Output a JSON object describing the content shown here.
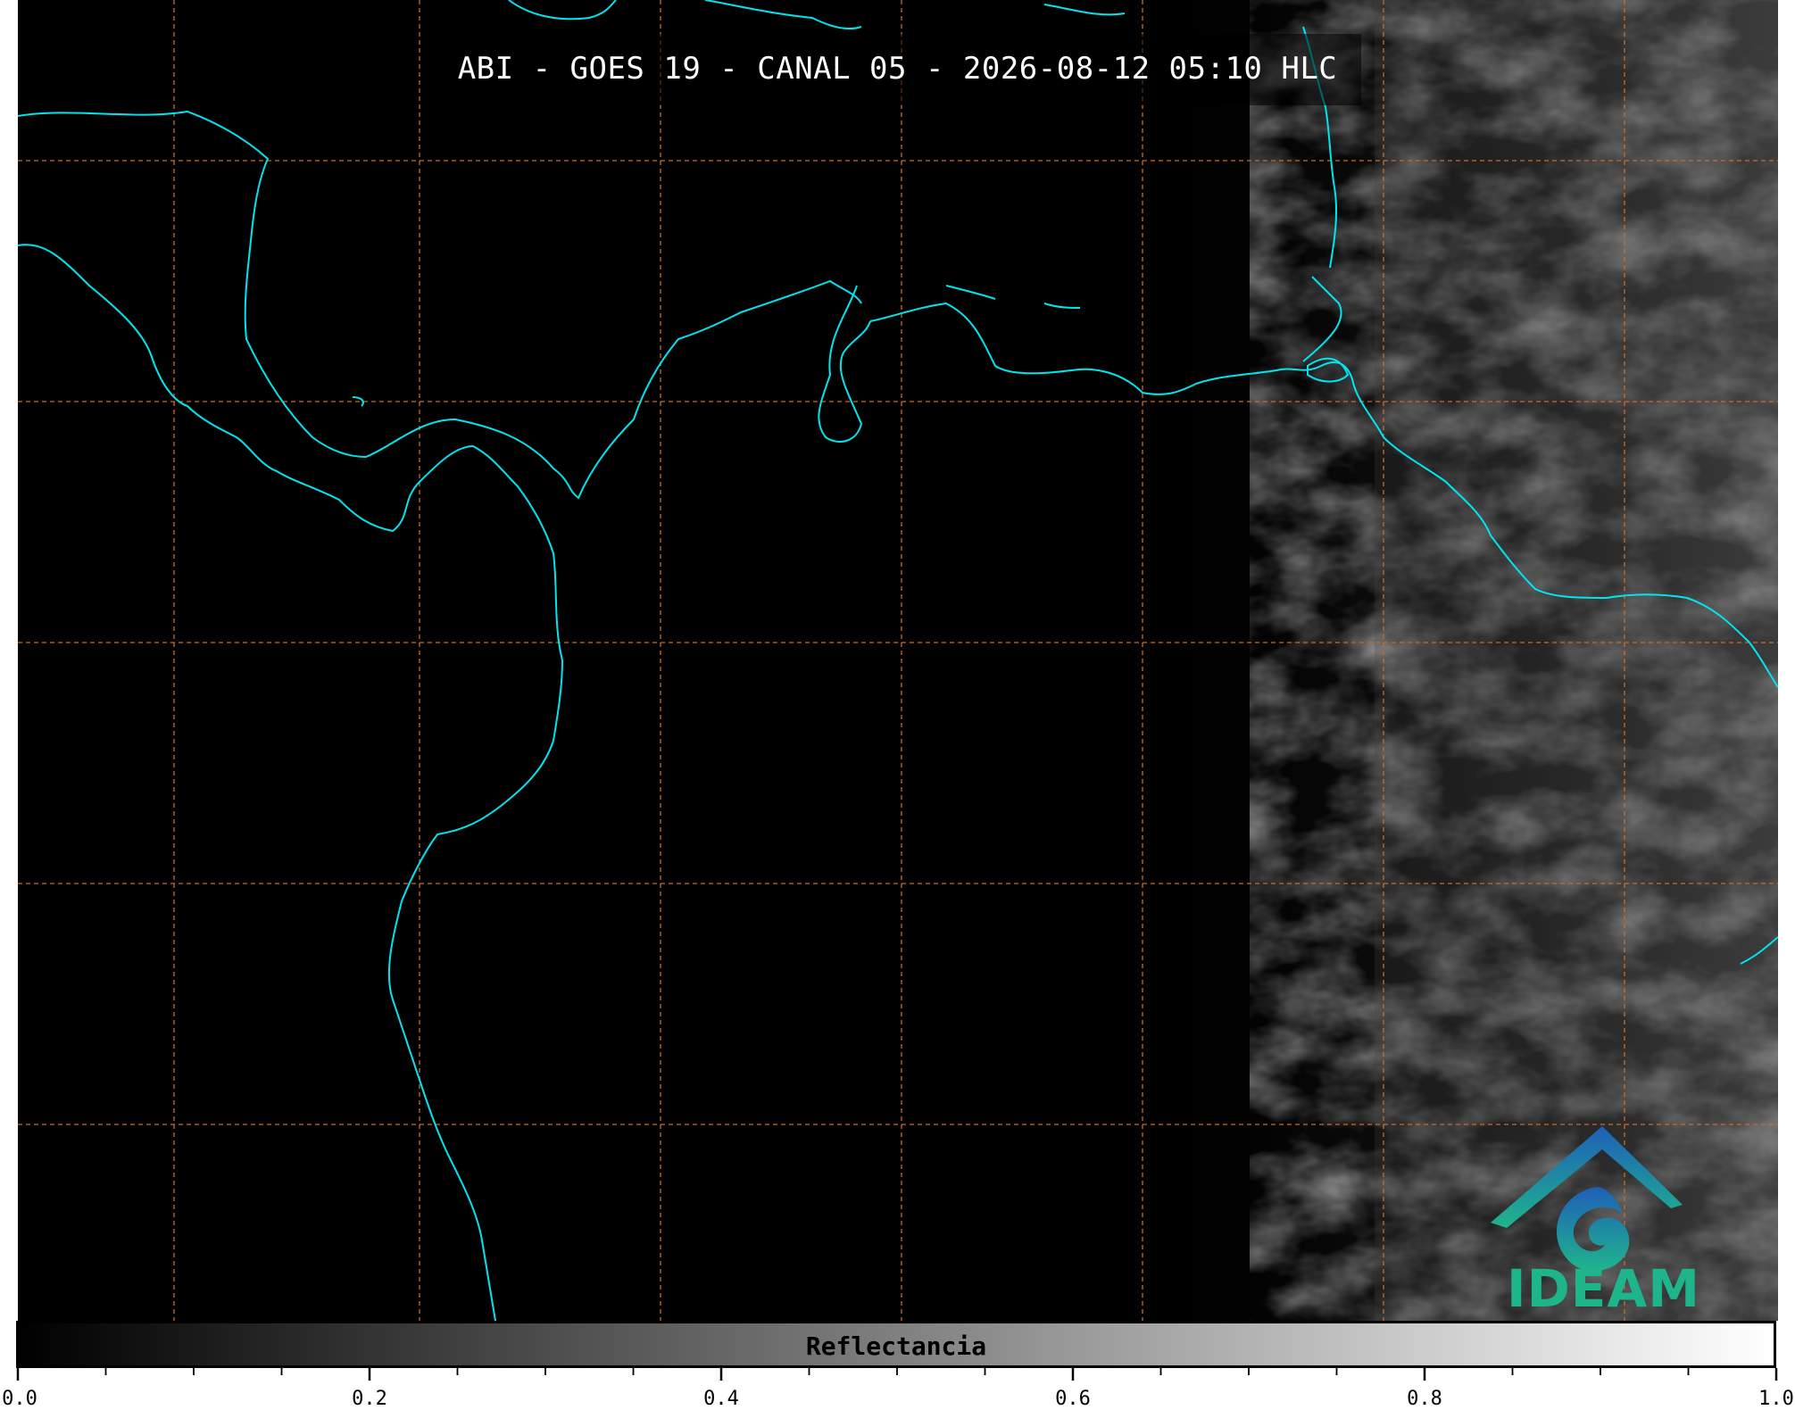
{
  "title": "ABI - GOES 19 - CANAL 05 - 2026-08-12 05:10 HLC",
  "logo": {
    "text": "IDEAM",
    "icon": "ideam-logo-icon",
    "color": "#1fb58c"
  },
  "colorbar": {
    "label": "Reflectancia",
    "ticks": [
      "0.0",
      "0.2",
      "0.4",
      "0.6",
      "0.8",
      "1.0"
    ],
    "range": [
      0.0,
      1.0
    ],
    "colors": {
      "low": "#000000",
      "high": "#ffffff"
    }
  },
  "colors": {
    "coastline": "#00e5ee",
    "grid": "#d2691e"
  }
}
